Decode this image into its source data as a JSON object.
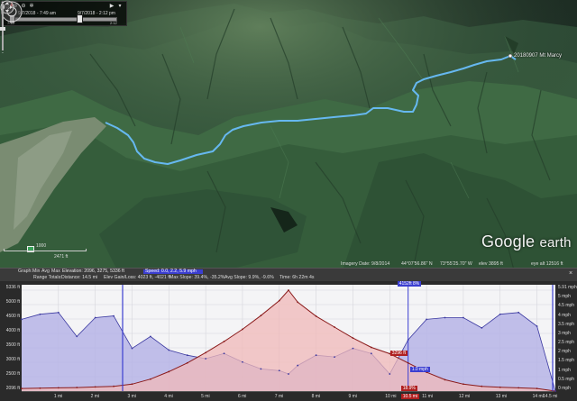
{
  "time_slider": {
    "start_label": "9/7/2018 - 7:49 am",
    "end_label": "9/7/2018 - 2:12 pm",
    "left_tick": "7:45",
    "right_tick": "2:12",
    "handle_start_fraction": 0.0,
    "handle_end_fraction": 0.65
  },
  "map": {
    "place_label": "20180907 Mt Marcy",
    "scale_value": "2471 ft",
    "scale_sub": "1000",
    "logo_google": "Google",
    "logo_earth": "earth"
  },
  "status_bar": {
    "imagery_date": "Imagery Date: 9/8/2014",
    "lat": "44°07'56.86\" N",
    "lon": "73°55'25.70\" W",
    "elev": "elev  3895 ft",
    "eye_alt": "eye alt  12516 ft"
  },
  "profile": {
    "row1_label": "Graph:",
    "row1_items": [
      "Min",
      "Avg",
      "Max"
    ],
    "row1_elevation": "Elevation:  2096, 3275, 5336 ft",
    "row1_speed": "Speed: 0.0, 2.2, 5.9 mph",
    "row2_range_totals": "Range Totals:",
    "row2_distance": "Distance: 14.5 mi",
    "row2_elev_gain": "Elev Gain/Loss: 4023 ft, -4021 ft",
    "row2_max_slope": "Max Slope: 39.4%, -35.2%",
    "row2_avg_slope": "Avg Slope: 9.9%, -9.6%",
    "row2_time": "Time: 6h 22m 4s",
    "cursor_top_label": "4152ft 8%",
    "cursor_pos_label": "10.5 mi",
    "marker_elev": "3296 ft",
    "marker_speed": "1.0 mph",
    "marker_pct": "18.9%",
    "close_icon_glyph": "×",
    "y_left_labels": [
      "5336 ft",
      "5000 ft",
      "4500 ft",
      "4000 ft",
      "3500 ft",
      "3000 ft",
      "2500 ft",
      "2096 ft"
    ],
    "y_right_labels": [
      "5.91 mph",
      "5 mph",
      "4.5 mph",
      "4 mph",
      "3.5 mph",
      "3 mph",
      "2.5 mph",
      "2 mph",
      "1.5 mph",
      "1 mph",
      "0.5 mph",
      "0 mph"
    ],
    "x_labels": [
      "1 mi",
      "2 mi",
      "3 mi",
      "4 mi",
      "5 mi",
      "6 mi",
      "7 mi",
      "8 mi",
      "9 mi",
      "10 mi",
      "11 mi",
      "12 mi",
      "13 mi",
      "14 mi",
      "14.5 mi"
    ],
    "colors": {
      "elevation_fill": "#f0b8b8",
      "elevation_line": "#8a1a1a",
      "speed_fill": "#b6b4e6",
      "speed_line": "#3a38a0",
      "track": "#66b8f0"
    }
  },
  "chart_data": {
    "type": "line",
    "xlabel": "",
    "ylabel": "",
    "x": [
      0,
      0.5,
      1,
      1.5,
      2,
      2.5,
      3,
      3.5,
      4,
      4.5,
      5,
      5.5,
      6,
      6.5,
      7,
      7.25,
      7.5,
      8,
      8.5,
      9,
      9.5,
      10,
      10.5,
      11,
      11.5,
      12,
      12.5,
      13,
      13.5,
      14,
      14.5
    ],
    "series": [
      {
        "values": [
          2180,
          2190,
          2200,
          2210,
          2230,
          2250,
          2320,
          2480,
          2720,
          3000,
          3330,
          3690,
          4080,
          4520,
          5000,
          5336,
          4950,
          4500,
          4150,
          3800,
          3500,
          3296,
          3000,
          2700,
          2460,
          2320,
          2250,
          2220,
          2200,
          2180,
          2096
        ]
      },
      {
        "values": [
          4.2,
          4.5,
          4.6,
          3.2,
          4.3,
          4.4,
          2.5,
          3.2,
          2.4,
          2.1,
          1.9,
          2.2,
          1.7,
          1.3,
          1.2,
          1.0,
          1.5,
          2.1,
          2.0,
          2.5,
          2.2,
          1.0,
          3.0,
          4.2,
          4.3,
          4.3,
          3.7,
          4.5,
          4.6,
          3.8,
          0.0
        ]
      }
    ],
    "ylim": [
      2096,
      5336
    ],
    "y2lim": [
      0,
      5.91
    ],
    "xlim": [
      0,
      14.5
    ],
    "cursor_x": 10.5
  }
}
